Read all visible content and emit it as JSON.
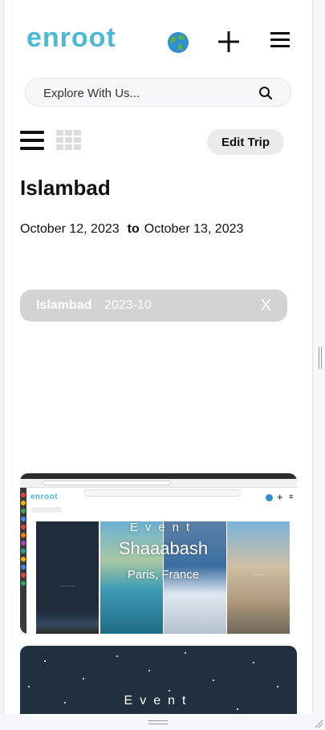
{
  "header": {
    "logo_text": "enroot",
    "icons": [
      "globe-icon",
      "plus-icon",
      "hamburger-menu-icon"
    ]
  },
  "search": {
    "placeholder": "Explore With Us...",
    "icon": "search-icon"
  },
  "toolbar": {
    "view_icons": [
      "list-view-icon",
      "grid-view-icon"
    ],
    "edit_label": "Edit Trip"
  },
  "trip": {
    "title": "Islambad",
    "start_date": "October 12, 2023",
    "separator": "to",
    "end_date": "October 13, 2023"
  },
  "destination_chip": {
    "city": "Islambad",
    "date": "2023-10",
    "close_label": "X"
  },
  "screenshot_card": {
    "logo_text": "enroot",
    "overlay_event": "Event",
    "overlay_name": "Shaaabash",
    "overlay_location": "Paris, France"
  },
  "event_card": {
    "label": "Event"
  },
  "colors": {
    "accent_logo": "#4bb8d6",
    "chip_bg": "#d3d3d3",
    "button_bg": "#ebebeb",
    "event_bg": "#20303f"
  }
}
